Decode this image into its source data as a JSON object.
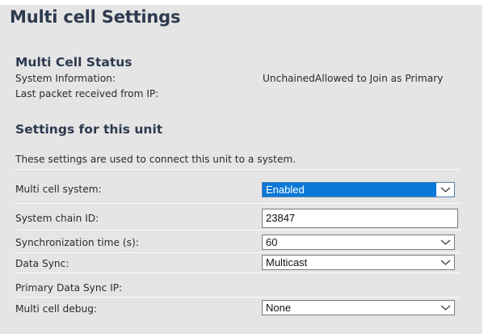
{
  "page": {
    "title": "Multi cell Settings"
  },
  "status": {
    "heading": "Multi Cell Status",
    "system_info_label": "System Information:",
    "system_info_value": "UnchainedAllowed to Join as Primary",
    "last_packet_label": "Last packet received from IP:",
    "last_packet_value": ""
  },
  "settings": {
    "heading": "Settings for this unit",
    "description": "These settings are used to connect this unit to a system.",
    "multi_cell_system": {
      "label": "Multi cell system:",
      "value": "Enabled"
    },
    "system_chain_id": {
      "label": "System chain ID:",
      "value": "23847"
    },
    "sync_time": {
      "label": "Synchronization time (s):",
      "value": "60"
    },
    "data_sync": {
      "label": "Data Sync:",
      "value": "Multicast"
    },
    "primary_ip": {
      "label": "Primary Data Sync IP:",
      "value": ""
    },
    "debug": {
      "label": "Multi cell debug:",
      "value": "None"
    }
  },
  "icons": {
    "dropdown": "chevron-down-icon"
  },
  "colors": {
    "panel": "#e5e5e5",
    "heading": "#2d3a4f",
    "selected_highlight": "#0a78d7"
  }
}
